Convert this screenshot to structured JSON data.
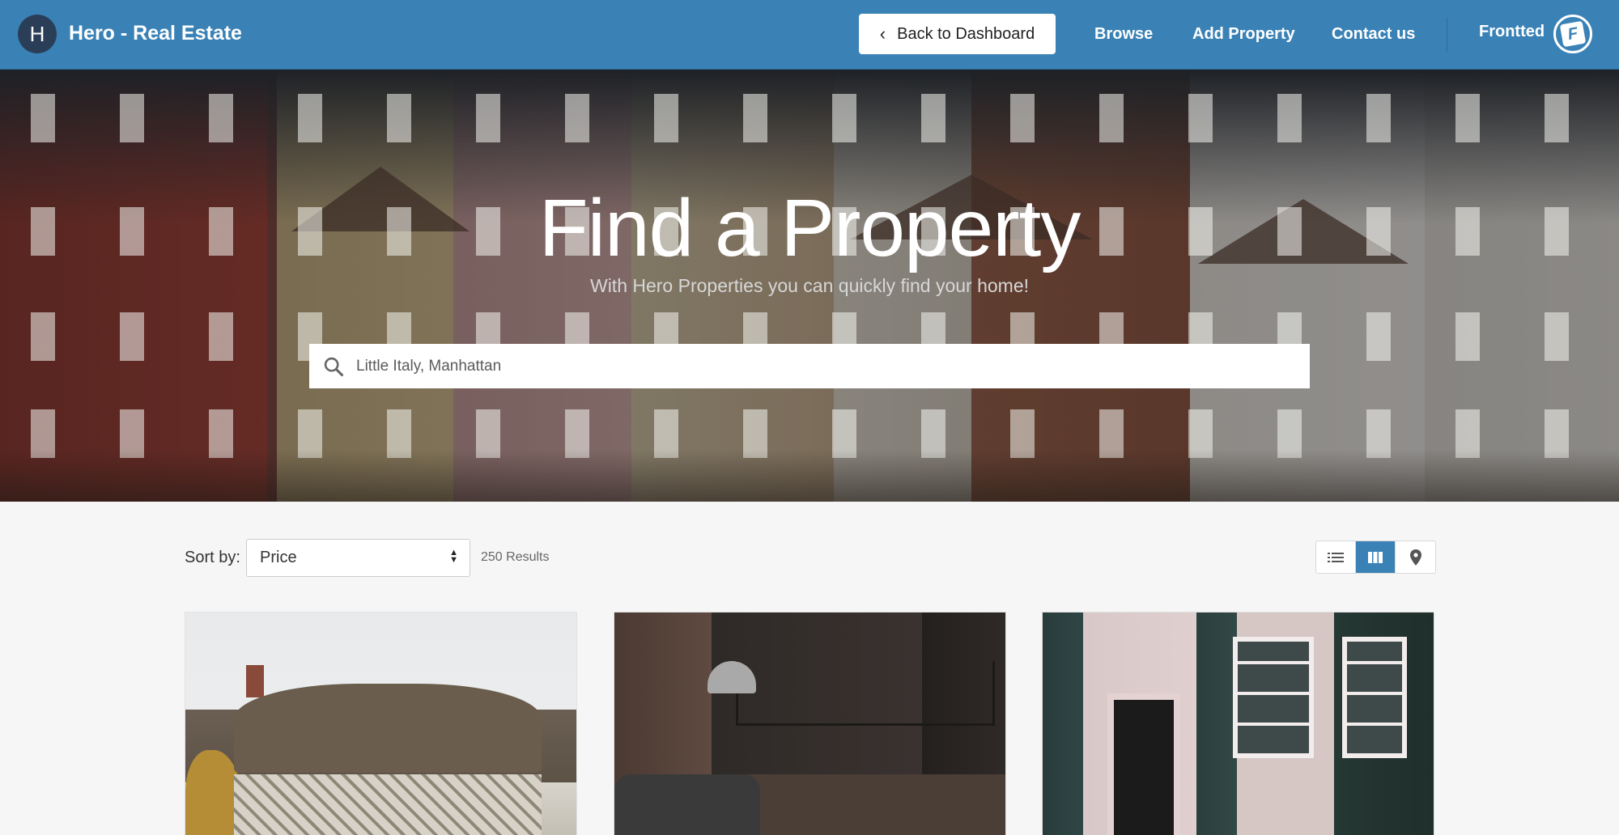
{
  "header": {
    "brand_initial": "H",
    "brand_name": "Hero - Real Estate",
    "back_button": "Back to Dashboard",
    "nav": [
      "Browse",
      "Add Property",
      "Contact us"
    ],
    "user_name": "Frontted",
    "user_logo_letter": "F"
  },
  "hero": {
    "title": "Find a Property",
    "subtitle": "With Hero Properties you can quickly find your home!",
    "search_placeholder": "Little Italy, Manhattan"
  },
  "toolbar": {
    "sort_label": "Sort by:",
    "sort_value": "Price",
    "results": "250 Results",
    "views": [
      "list-view",
      "grid-view",
      "map-view"
    ],
    "active_view": "grid-view"
  },
  "colors": {
    "primary": "#3a82b6",
    "brand_avatar": "#2a3f57"
  }
}
